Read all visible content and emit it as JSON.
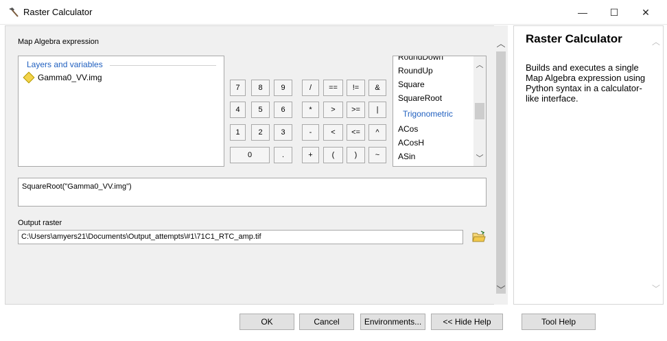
{
  "window": {
    "title": "Raster Calculator",
    "controls": {
      "minimize": "—",
      "maximize": "☐",
      "close": "✕"
    }
  },
  "left": {
    "section_label": "Map Algebra expression",
    "layers": {
      "header": "Layers and variables",
      "items": [
        "Gamma0_VV.img"
      ]
    },
    "keypad": {
      "row1": [
        "7",
        "8",
        "9",
        "/",
        "==",
        "!=",
        "&"
      ],
      "row2": [
        "4",
        "5",
        "6",
        "*",
        ">",
        ">=",
        "|"
      ],
      "row3": [
        "1",
        "2",
        "3",
        "-",
        "<",
        "<=",
        "^"
      ],
      "row4": [
        "0",
        ".",
        "+",
        "(",
        ")",
        "~"
      ]
    },
    "functions": {
      "items": [
        "RoundDown",
        "RoundUp",
        "Square",
        "SquareRoot"
      ],
      "category": "Trigonometric",
      "items2": [
        "ACos",
        "ACosH",
        "ASin"
      ]
    },
    "expression": "SquareRoot(\"Gamma0_VV.img\")",
    "output_label": "Output raster",
    "output_value": "C:\\Users\\amyers21\\Documents\\Output_attempts\\#1\\71C1_RTC_amp.tif"
  },
  "help": {
    "title": "Raster Calculator",
    "body": "Builds and executes a single Map Algebra expression using Python syntax in a calculator-like interface."
  },
  "buttons": {
    "ok": "OK",
    "cancel": "Cancel",
    "environments": "Environments...",
    "hide_help": "<< Hide Help",
    "tool_help": "Tool Help"
  },
  "icons": {
    "title": "hammer-icon",
    "layer": "raster-layer-icon",
    "browse": "folder-open-icon"
  }
}
